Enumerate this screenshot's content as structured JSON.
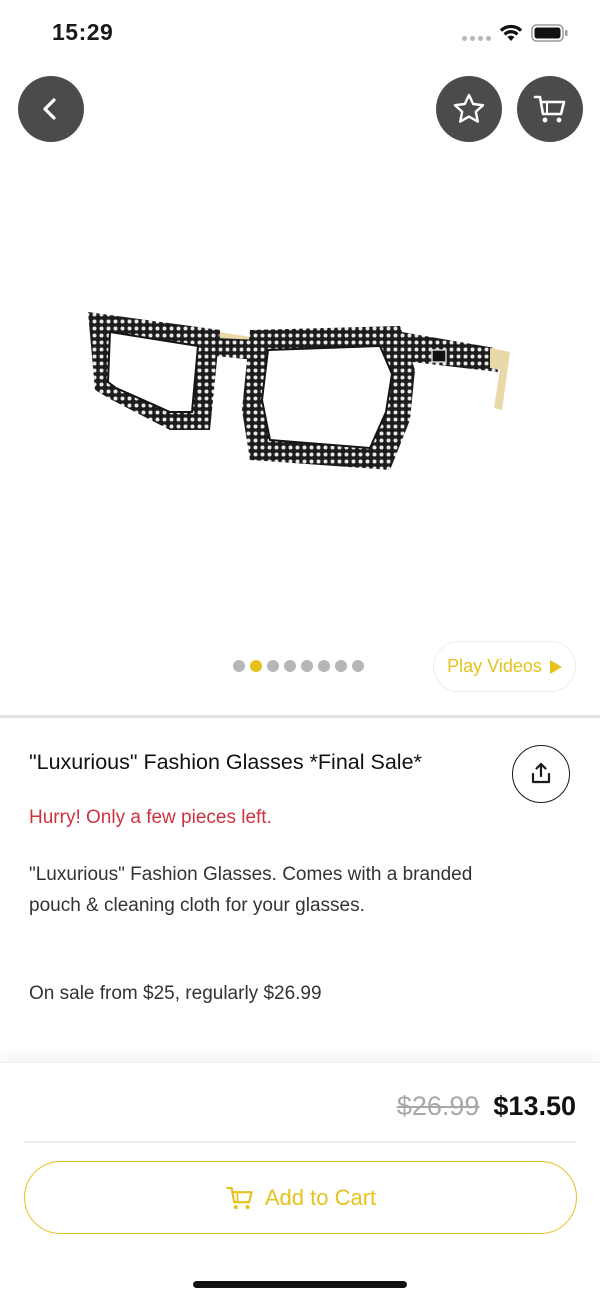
{
  "status_bar": {
    "time": "15:29"
  },
  "header": {
    "back_icon": "chevron-left-icon",
    "favorite_icon": "star-outline-icon",
    "cart_icon": "cart-icon",
    "button_color": "#4b4b4b"
  },
  "gallery": {
    "image": "rhinestone-square-glasses",
    "total_images": 8,
    "active_index": 1,
    "play_videos_label": "Play Videos"
  },
  "product": {
    "title": "\"Luxurious\" Fashion Glasses *Final Sale*",
    "stock_warning": "Hurry! Only a few pieces left.",
    "description": "\"Luxurious\" Fashion Glasses. Comes with a branded pouch & cleaning cloth for your glasses.",
    "sale_info": "On sale from $25, regularly $26.99",
    "share_icon": "share-icon"
  },
  "purchase": {
    "old_price": "$26.99",
    "new_price": "$13.50",
    "add_to_cart_label": "Add to Cart"
  },
  "colors": {
    "accent": "#e6c21d",
    "warning": "#d0313f",
    "muted": "#a8a8a8"
  }
}
